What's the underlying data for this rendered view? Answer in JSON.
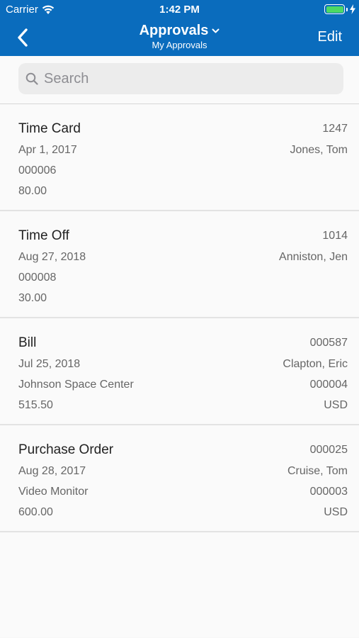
{
  "status_bar": {
    "carrier": "Carrier",
    "time": "1:42 PM"
  },
  "nav": {
    "title": "Approvals",
    "subtitle": "My Approvals",
    "edit_label": "Edit"
  },
  "search": {
    "placeholder": "Search"
  },
  "items": [
    {
      "title": "Time Card",
      "id": "1247",
      "date": "Apr 1, 2017",
      "person": "Jones, Tom",
      "line3_left": "000006",
      "line3_right": "",
      "line4_left": "80.00",
      "line4_right": ""
    },
    {
      "title": "Time Off",
      "id": "1014",
      "date": "Aug 27, 2018",
      "person": "Anniston, Jen",
      "line3_left": "000008",
      "line3_right": "",
      "line4_left": "30.00",
      "line4_right": ""
    },
    {
      "title": "Bill",
      "id": "000587",
      "date": "Jul 25, 2018",
      "person": "Clapton, Eric",
      "line3_left": "Johnson Space Center",
      "line3_right": "000004",
      "line4_left": "515.50",
      "line4_right": "USD"
    },
    {
      "title": "Purchase Order",
      "id": "000025",
      "date": "Aug 28, 2017",
      "person": "Cruise, Tom",
      "line3_left": "Video Monitor",
      "line3_right": "000003",
      "line4_left": "600.00",
      "line4_right": "USD"
    }
  ],
  "colors": {
    "header": "#0a6cbd",
    "battery": "#4cd964"
  }
}
